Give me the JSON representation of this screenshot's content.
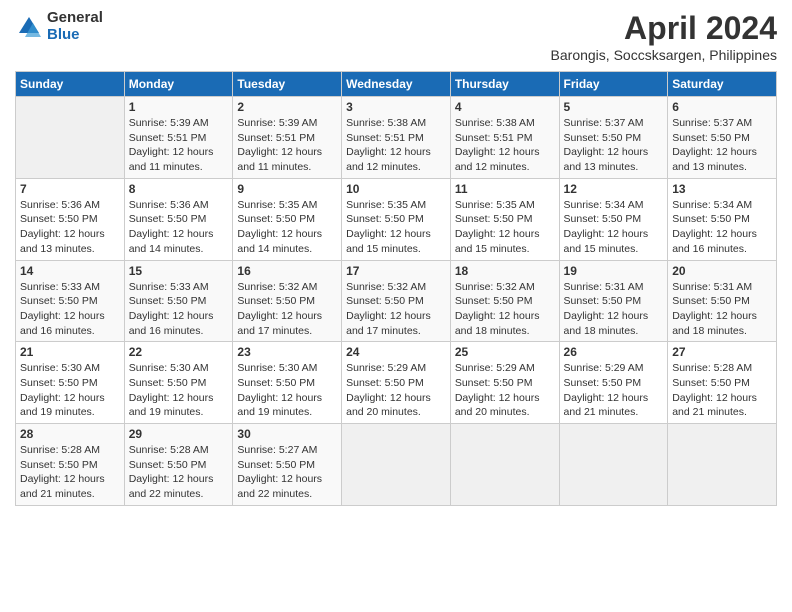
{
  "logo": {
    "general": "General",
    "blue": "Blue"
  },
  "title": "April 2024",
  "location": "Barongis, Soccsksargen, Philippines",
  "weekdays": [
    "Sunday",
    "Monday",
    "Tuesday",
    "Wednesday",
    "Thursday",
    "Friday",
    "Saturday"
  ],
  "weeks": [
    [
      {
        "day": "",
        "info": ""
      },
      {
        "day": "1",
        "info": "Sunrise: 5:39 AM\nSunset: 5:51 PM\nDaylight: 12 hours\nand 11 minutes."
      },
      {
        "day": "2",
        "info": "Sunrise: 5:39 AM\nSunset: 5:51 PM\nDaylight: 12 hours\nand 11 minutes."
      },
      {
        "day": "3",
        "info": "Sunrise: 5:38 AM\nSunset: 5:51 PM\nDaylight: 12 hours\nand 12 minutes."
      },
      {
        "day": "4",
        "info": "Sunrise: 5:38 AM\nSunset: 5:51 PM\nDaylight: 12 hours\nand 12 minutes."
      },
      {
        "day": "5",
        "info": "Sunrise: 5:37 AM\nSunset: 5:50 PM\nDaylight: 12 hours\nand 13 minutes."
      },
      {
        "day": "6",
        "info": "Sunrise: 5:37 AM\nSunset: 5:50 PM\nDaylight: 12 hours\nand 13 minutes."
      }
    ],
    [
      {
        "day": "7",
        "info": "Sunrise: 5:36 AM\nSunset: 5:50 PM\nDaylight: 12 hours\nand 13 minutes."
      },
      {
        "day": "8",
        "info": "Sunrise: 5:36 AM\nSunset: 5:50 PM\nDaylight: 12 hours\nand 14 minutes."
      },
      {
        "day": "9",
        "info": "Sunrise: 5:35 AM\nSunset: 5:50 PM\nDaylight: 12 hours\nand 14 minutes."
      },
      {
        "day": "10",
        "info": "Sunrise: 5:35 AM\nSunset: 5:50 PM\nDaylight: 12 hours\nand 15 minutes."
      },
      {
        "day": "11",
        "info": "Sunrise: 5:35 AM\nSunset: 5:50 PM\nDaylight: 12 hours\nand 15 minutes."
      },
      {
        "day": "12",
        "info": "Sunrise: 5:34 AM\nSunset: 5:50 PM\nDaylight: 12 hours\nand 15 minutes."
      },
      {
        "day": "13",
        "info": "Sunrise: 5:34 AM\nSunset: 5:50 PM\nDaylight: 12 hours\nand 16 minutes."
      }
    ],
    [
      {
        "day": "14",
        "info": "Sunrise: 5:33 AM\nSunset: 5:50 PM\nDaylight: 12 hours\nand 16 minutes."
      },
      {
        "day": "15",
        "info": "Sunrise: 5:33 AM\nSunset: 5:50 PM\nDaylight: 12 hours\nand 16 minutes."
      },
      {
        "day": "16",
        "info": "Sunrise: 5:32 AM\nSunset: 5:50 PM\nDaylight: 12 hours\nand 17 minutes."
      },
      {
        "day": "17",
        "info": "Sunrise: 5:32 AM\nSunset: 5:50 PM\nDaylight: 12 hours\nand 17 minutes."
      },
      {
        "day": "18",
        "info": "Sunrise: 5:32 AM\nSunset: 5:50 PM\nDaylight: 12 hours\nand 18 minutes."
      },
      {
        "day": "19",
        "info": "Sunrise: 5:31 AM\nSunset: 5:50 PM\nDaylight: 12 hours\nand 18 minutes."
      },
      {
        "day": "20",
        "info": "Sunrise: 5:31 AM\nSunset: 5:50 PM\nDaylight: 12 hours\nand 18 minutes."
      }
    ],
    [
      {
        "day": "21",
        "info": "Sunrise: 5:30 AM\nSunset: 5:50 PM\nDaylight: 12 hours\nand 19 minutes."
      },
      {
        "day": "22",
        "info": "Sunrise: 5:30 AM\nSunset: 5:50 PM\nDaylight: 12 hours\nand 19 minutes."
      },
      {
        "day": "23",
        "info": "Sunrise: 5:30 AM\nSunset: 5:50 PM\nDaylight: 12 hours\nand 19 minutes."
      },
      {
        "day": "24",
        "info": "Sunrise: 5:29 AM\nSunset: 5:50 PM\nDaylight: 12 hours\nand 20 minutes."
      },
      {
        "day": "25",
        "info": "Sunrise: 5:29 AM\nSunset: 5:50 PM\nDaylight: 12 hours\nand 20 minutes."
      },
      {
        "day": "26",
        "info": "Sunrise: 5:29 AM\nSunset: 5:50 PM\nDaylight: 12 hours\nand 21 minutes."
      },
      {
        "day": "27",
        "info": "Sunrise: 5:28 AM\nSunset: 5:50 PM\nDaylight: 12 hours\nand 21 minutes."
      }
    ],
    [
      {
        "day": "28",
        "info": "Sunrise: 5:28 AM\nSunset: 5:50 PM\nDaylight: 12 hours\nand 21 minutes."
      },
      {
        "day": "29",
        "info": "Sunrise: 5:28 AM\nSunset: 5:50 PM\nDaylight: 12 hours\nand 22 minutes."
      },
      {
        "day": "30",
        "info": "Sunrise: 5:27 AM\nSunset: 5:50 PM\nDaylight: 12 hours\nand 22 minutes."
      },
      {
        "day": "",
        "info": ""
      },
      {
        "day": "",
        "info": ""
      },
      {
        "day": "",
        "info": ""
      },
      {
        "day": "",
        "info": ""
      }
    ]
  ]
}
